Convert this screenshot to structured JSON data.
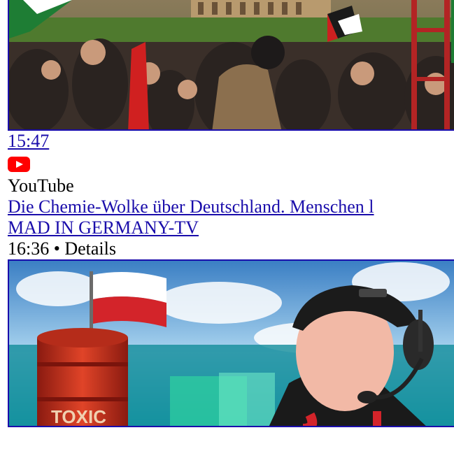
{
  "result1": {
    "duration": "15:47"
  },
  "result2": {
    "source": "YouTube",
    "title": "Die Chemie-Wolke über Deutschland. Menschen l",
    "channel": "MAD IN GERMANY-TV",
    "meta": "16:36 • Details",
    "thumbnail_text": "TOXIC"
  },
  "colors": {
    "link": "#1a0dab",
    "youtube_red": "#ff0000"
  },
  "icons": {
    "source_icon": "youtube-play-icon"
  }
}
